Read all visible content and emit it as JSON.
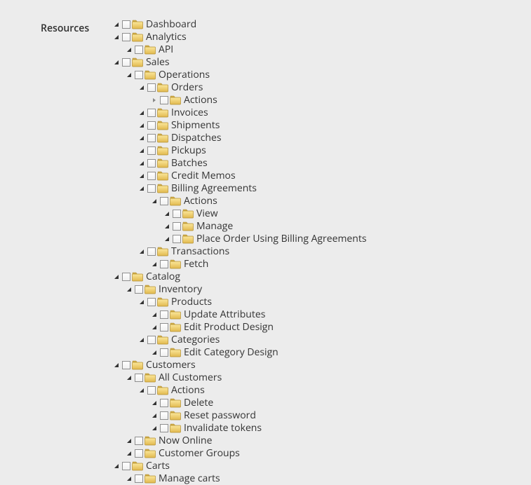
{
  "title": "Resources",
  "tree": [
    {
      "level": 0,
      "toggle": "expanded",
      "path": "n.0.label",
      "label": "Dashboard"
    },
    {
      "level": 0,
      "toggle": "expanded",
      "path": "n.1.label",
      "label": "Analytics"
    },
    {
      "level": 1,
      "toggle": "expanded",
      "path": "n.2.label",
      "label": "API"
    },
    {
      "level": 0,
      "toggle": "expanded",
      "path": "n.3.label",
      "label": "Sales"
    },
    {
      "level": 1,
      "toggle": "expanded",
      "path": "n.4.label",
      "label": "Operations"
    },
    {
      "level": 2,
      "toggle": "expanded",
      "path": "n.5.label",
      "label": "Orders"
    },
    {
      "level": 3,
      "toggle": "collapsed",
      "path": "n.6.label",
      "label": "Actions"
    },
    {
      "level": 2,
      "toggle": "expanded",
      "path": "n.7.label",
      "label": "Invoices"
    },
    {
      "level": 2,
      "toggle": "expanded",
      "path": "n.8.label",
      "label": "Shipments"
    },
    {
      "level": 2,
      "toggle": "expanded",
      "path": "n.9.label",
      "label": "Dispatches"
    },
    {
      "level": 2,
      "toggle": "expanded",
      "path": "n.10.label",
      "label": "Pickups"
    },
    {
      "level": 2,
      "toggle": "expanded",
      "path": "n.11.label",
      "label": "Batches"
    },
    {
      "level": 2,
      "toggle": "expanded",
      "path": "n.12.label",
      "label": "Credit Memos"
    },
    {
      "level": 2,
      "toggle": "expanded",
      "path": "n.13.label",
      "label": "Billing Agreements"
    },
    {
      "level": 3,
      "toggle": "expanded",
      "path": "n.14.label",
      "label": "Actions"
    },
    {
      "level": 4,
      "toggle": "expanded",
      "path": "n.15.label",
      "label": "View"
    },
    {
      "level": 4,
      "toggle": "expanded",
      "path": "n.16.label",
      "label": "Manage"
    },
    {
      "level": 4,
      "toggle": "expanded",
      "path": "n.17.label",
      "label": "Place Order Using Billing Agreements"
    },
    {
      "level": 2,
      "toggle": "expanded",
      "path": "n.18.label",
      "label": "Transactions"
    },
    {
      "level": 3,
      "toggle": "expanded",
      "path": "n.19.label",
      "label": "Fetch"
    },
    {
      "level": 0,
      "toggle": "expanded",
      "path": "n.20.label",
      "label": "Catalog"
    },
    {
      "level": 1,
      "toggle": "expanded",
      "path": "n.21.label",
      "label": "Inventory"
    },
    {
      "level": 2,
      "toggle": "expanded",
      "path": "n.22.label",
      "label": "Products"
    },
    {
      "level": 3,
      "toggle": "expanded",
      "path": "n.23.label",
      "label": "Update Attributes"
    },
    {
      "level": 3,
      "toggle": "expanded",
      "path": "n.24.label",
      "label": "Edit Product Design"
    },
    {
      "level": 2,
      "toggle": "expanded",
      "path": "n.25.label",
      "label": "Categories"
    },
    {
      "level": 3,
      "toggle": "expanded",
      "path": "n.26.label",
      "label": "Edit Category Design"
    },
    {
      "level": 0,
      "toggle": "expanded",
      "path": "n.27.label",
      "label": "Customers"
    },
    {
      "level": 1,
      "toggle": "expanded",
      "path": "n.28.label",
      "label": "All Customers"
    },
    {
      "level": 2,
      "toggle": "expanded",
      "path": "n.29.label",
      "label": "Actions"
    },
    {
      "level": 3,
      "toggle": "expanded",
      "path": "n.30.label",
      "label": "Delete"
    },
    {
      "level": 3,
      "toggle": "expanded",
      "path": "n.31.label",
      "label": "Reset password"
    },
    {
      "level": 3,
      "toggle": "expanded",
      "path": "n.32.label",
      "label": "Invalidate tokens"
    },
    {
      "level": 1,
      "toggle": "expanded",
      "path": "n.33.label",
      "label": "Now Online"
    },
    {
      "level": 1,
      "toggle": "expanded",
      "path": "n.34.label",
      "label": "Customer Groups"
    },
    {
      "level": 0,
      "toggle": "expanded",
      "path": "n.35.label",
      "label": "Carts"
    },
    {
      "level": 1,
      "toggle": "expanded",
      "path": "n.36.label",
      "label": "Manage carts"
    }
  ],
  "n": [
    {
      "label": "Dashboard"
    },
    {
      "label": "Analytics"
    },
    {
      "label": "API"
    },
    {
      "label": "Sales"
    },
    {
      "label": "Operations"
    },
    {
      "label": "Orders"
    },
    {
      "label": "Actions"
    },
    {
      "label": "Invoices"
    },
    {
      "label": "Shipments"
    },
    {
      "label": "Dispatches"
    },
    {
      "label": "Pickups"
    },
    {
      "label": "Batches"
    },
    {
      "label": "Credit Memos"
    },
    {
      "label": "Billing Agreements"
    },
    {
      "label": "Actions"
    },
    {
      "label": "View"
    },
    {
      "label": "Manage"
    },
    {
      "label": "Place Order Using Billing Agreements"
    },
    {
      "label": "Transactions"
    },
    {
      "label": "Fetch"
    },
    {
      "label": "Catalog"
    },
    {
      "label": "Inventory"
    },
    {
      "label": "Products"
    },
    {
      "label": "Update Attributes"
    },
    {
      "label": "Edit Product Design"
    },
    {
      "label": "Categories"
    },
    {
      "label": "Edit Category Design"
    },
    {
      "label": "Customers"
    },
    {
      "label": "All Customers"
    },
    {
      "label": "Actions"
    },
    {
      "label": "Delete"
    },
    {
      "label": "Reset password"
    },
    {
      "label": "Invalidate tokens"
    },
    {
      "label": "Now Online"
    },
    {
      "label": "Customer Groups"
    },
    {
      "label": "Carts"
    },
    {
      "label": "Manage carts"
    }
  ]
}
